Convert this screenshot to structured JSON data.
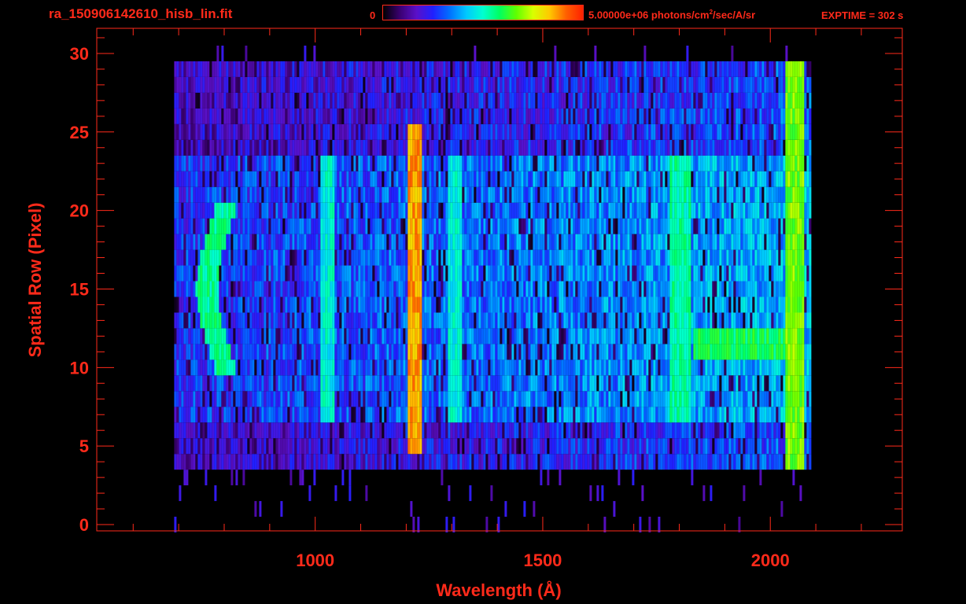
{
  "header": {
    "filename": "ra_150906142610_hisb_lin.fit",
    "colorbar_min": "0",
    "colorbar_max_prefix": "5.00000e+06 photons/cm",
    "colorbar_max_exp": "2",
    "colorbar_max_suffix": "/sec/A/sr",
    "exptime": "EXPTIME = 302 s"
  },
  "colors": {
    "axis": "#ff2a1a",
    "background": "#000000",
    "colorbar_stops": [
      "#000000",
      "#3a0070",
      "#5a10c8",
      "#2020ff",
      "#0070ff",
      "#00c8ff",
      "#00ffd0",
      "#00ff60",
      "#60ff00",
      "#d8ff00",
      "#ffc800",
      "#ff6000",
      "#ff2000"
    ]
  },
  "chart_data": {
    "type": "heatmap",
    "xlabel": "Wavelength (Å)",
    "ylabel": "Spatial Row (Pixel)",
    "xlim": [
      520,
      2290
    ],
    "ylim": [
      -0.4,
      31.6
    ],
    "xticks": [
      1000,
      1500,
      2000
    ],
    "yticks": [
      0,
      5,
      10,
      15,
      20,
      25,
      30
    ],
    "x_minor_step": 100,
    "y_minor_step": 1,
    "intensity_range": [
      0,
      5000000
    ],
    "rows": 31,
    "wavelength_coverage": [
      690,
      2060
    ],
    "features": [
      {
        "label": "arc",
        "wavelength": 800,
        "rows": [
          10,
          20
        ],
        "level": 0.55
      },
      {
        "label": "line",
        "wavelength": 1025,
        "rows": [
          7,
          23
        ],
        "level": 0.5
      },
      {
        "label": "line",
        "wavelength": 1216,
        "rows": [
          5,
          25
        ],
        "level": 0.88
      },
      {
        "label": "line",
        "wavelength": 1304,
        "rows": [
          7,
          23
        ],
        "level": 0.5
      },
      {
        "label": "band",
        "wavelength": 1800,
        "rows": [
          7,
          23
        ],
        "level": 0.55
      },
      {
        "label": "band",
        "wavelength": 2050,
        "rows": [
          3,
          29
        ],
        "level": 0.7
      },
      {
        "label": "bright-row",
        "wavelength": 1950,
        "rows": [
          11,
          12
        ],
        "level": 0.6
      }
    ]
  }
}
